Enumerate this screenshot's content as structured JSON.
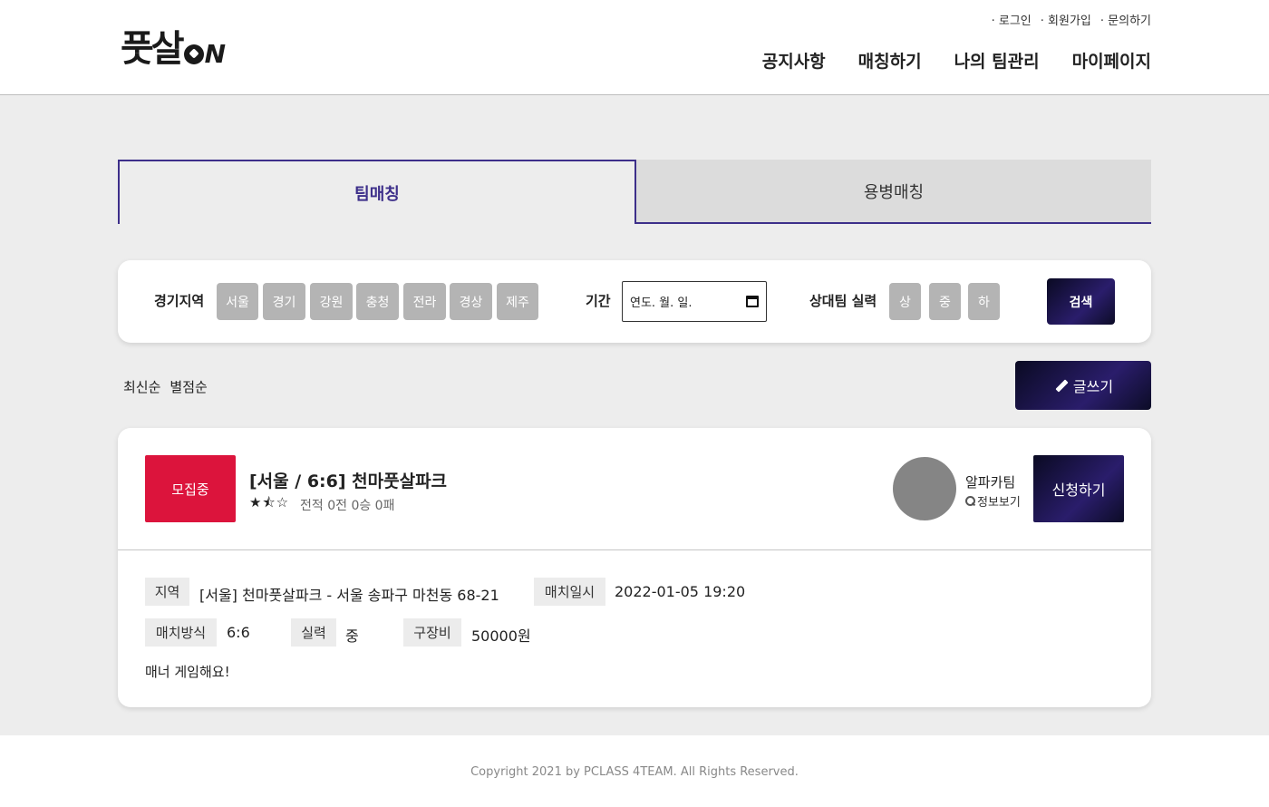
{
  "header": {
    "logo_text": "풋살",
    "logo_suffix": "N",
    "util": [
      "로그인",
      "회원가입",
      "문의하기"
    ],
    "nav": [
      "공지사항",
      "매칭하기",
      "나의 팀관리",
      "마이페이지"
    ]
  },
  "tabs": [
    "팀매칭",
    "용병매칭"
  ],
  "filter": {
    "region_label": "경기지역",
    "regions": [
      "서울",
      "경기",
      "강원",
      "충청",
      "전라",
      "경상",
      "제주"
    ],
    "period_label": "기간",
    "date_placeholder": "연도. 월. 일.",
    "skill_label": "상대팀 실력",
    "skills": [
      "상",
      "중",
      "하"
    ],
    "search_label": "검색"
  },
  "sort": [
    "최신순",
    "별점순"
  ],
  "write_label": "글쓰기",
  "card": {
    "status": "모집중",
    "title": "[서울 / 6:6] 천마풋살파크",
    "stars": "★⯪☆",
    "record": "전적 0전 0승 0패",
    "team_name": "알파카팀",
    "info_label": "정보보기",
    "apply_label": "신청하기",
    "fields": {
      "region_tag": "지역",
      "region_value": "[서울] 천마풋살파크 - 서울 송파구 마천동 68-21",
      "datetime_tag": "매치일시",
      "datetime_value": "2022-01-05 19:20",
      "method_tag": "매치방식",
      "method_value": "6:6",
      "skill_tag": "실력",
      "skill_value": "중",
      "fee_tag": "구장비",
      "fee_value": "50000원"
    },
    "memo": "매너 게임해요!"
  },
  "footer": {
    "copyright": "Copyright 2021 by PCLASS 4TEAM. All Rights Reserved."
  },
  "colors": {
    "accent": "#3d2f8a",
    "status_red": "#dc143c",
    "chip_gray": "#b4b4b4"
  }
}
